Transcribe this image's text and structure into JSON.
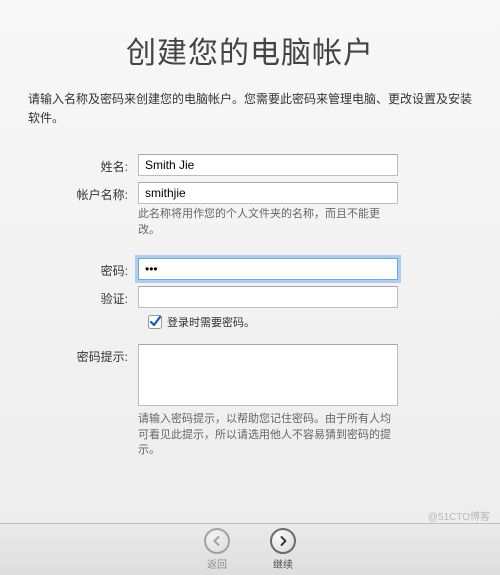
{
  "title": "创建您的电脑帐户",
  "subtitle": "请输入名称及密码来创建您的电脑帐户。您需要此密码来管理电脑、更改设置及安装软件。",
  "form": {
    "full_name_label": "姓名:",
    "full_name_value": "Smith Jie",
    "account_name_label": "帐户名称:",
    "account_name_value": "smithjie",
    "account_name_hint": "此名称将用作您的个人文件夹的名称，而且不能更改。",
    "password_label": "密码:",
    "password_value": "•••",
    "verify_label": "验证:",
    "verify_value": "",
    "require_password_label": "登录时需要密码。",
    "require_password_checked": true,
    "hint_label": "密码提示:",
    "hint_value": "",
    "hint_description": "请输入密码提示，以帮助您记住密码。由于所有人均可看见此提示，所以请选用他人不容易猜到密码的提示。"
  },
  "footer": {
    "back_label": "返回",
    "continue_label": "继续"
  },
  "watermark": "@51CTO博客"
}
